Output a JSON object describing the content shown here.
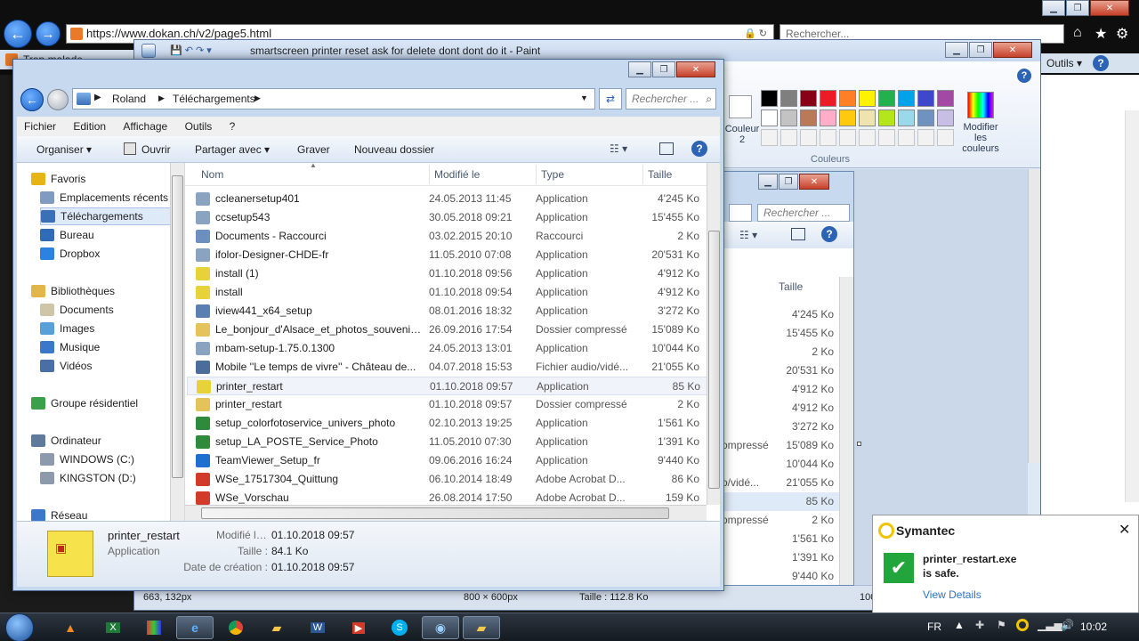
{
  "browser": {
    "url": "https://www.dokan.ch/v2/page5.html",
    "search_placeholder": "Rechercher...",
    "tab_label": "Trop malade",
    "toolbar_tools_label": "Outils"
  },
  "paint": {
    "title": "smartscreen printer reset ask for delete dont dont do it - Paint",
    "color2_label": "Couleur 2",
    "edit_colors_label": "Modifier les couleurs",
    "colors_group_label": "Couleurs",
    "status_pos": "663, 132px",
    "status_dim": "800 × 600px",
    "status_size": "Taille : 112.8 Ko",
    "status_zoom": "100%",
    "palette_row1": [
      "#000000",
      "#7f7f7f",
      "#880015",
      "#ed1c24",
      "#ff7f27",
      "#fff200",
      "#22b14c",
      "#00a2e8",
      "#3f48cc",
      "#a349a4"
    ],
    "palette_row2": [
      "#ffffff",
      "#c3c3c3",
      "#b97a57",
      "#ffaec9",
      "#ffc90e",
      "#efe4b0",
      "#b5e61d",
      "#99d9ea",
      "#7092be",
      "#c8bfe7"
    ]
  },
  "bg_explorer": {
    "search_placeholder": "Rechercher ...",
    "size_header": "Taille",
    "rows": [
      {
        "type": "",
        "size": "4'245 Ko"
      },
      {
        "type": "",
        "size": "15'455 Ko"
      },
      {
        "type": "",
        "size": "2 Ko"
      },
      {
        "type": "",
        "size": "20'531 Ko"
      },
      {
        "type": "",
        "size": "4'912 Ko"
      },
      {
        "type": "",
        "size": "4'912 Ko"
      },
      {
        "type": "",
        "size": "3'272 Ko"
      },
      {
        "type": "ompressé",
        "size": "15'089 Ko"
      },
      {
        "type": "",
        "size": "10'044 Ko"
      },
      {
        "type": "o/vidé...",
        "size": "21'055 Ko"
      },
      {
        "type": "",
        "size": "85 Ko"
      },
      {
        "type": "ompressé",
        "size": "2 Ko"
      },
      {
        "type": "",
        "size": "1'561 Ko"
      },
      {
        "type": "",
        "size": "1'391 Ko"
      },
      {
        "type": "",
        "size": "9'440 Ko"
      }
    ]
  },
  "explorer": {
    "breadcrumb": [
      "Roland",
      "Téléchargements"
    ],
    "search_placeholder": "Rechercher ...",
    "menu": [
      "Fichier",
      "Edition",
      "Affichage",
      "Outils",
      "?"
    ],
    "toolbar": {
      "organize": "Organiser",
      "open": "Ouvrir",
      "share": "Partager avec",
      "burn": "Graver",
      "new_folder": "Nouveau dossier"
    },
    "nav": [
      {
        "label": "Favoris",
        "icon": "star-icon",
        "color": "#e7b416",
        "indent": 0
      },
      {
        "label": "Emplacements récents",
        "icon": "recent-icon",
        "color": "#7f9bc2",
        "indent": 1
      },
      {
        "label": "Téléchargements",
        "icon": "downloads-icon",
        "color": "#3b6fb6",
        "indent": 1,
        "selected": true
      },
      {
        "label": "Bureau",
        "icon": "desktop-icon",
        "color": "#2f6bb8",
        "indent": 1
      },
      {
        "label": "Dropbox",
        "icon": "dropbox-icon",
        "color": "#2b82e0",
        "indent": 1
      },
      {
        "label": "Bibliothèques",
        "icon": "libraries-icon",
        "color": "#e4b64a",
        "indent": 0
      },
      {
        "label": "Documents",
        "icon": "documents-icon",
        "color": "#cfc6a8",
        "indent": 1
      },
      {
        "label": "Images",
        "icon": "images-icon",
        "color": "#5aa0d8",
        "indent": 1
      },
      {
        "label": "Musique",
        "icon": "music-icon",
        "color": "#3b78c9",
        "indent": 1
      },
      {
        "label": "Vidéos",
        "icon": "videos-icon",
        "color": "#4a6fa5",
        "indent": 1
      },
      {
        "label": "Groupe résidentiel",
        "icon": "homegroup-icon",
        "color": "#3aa04a",
        "indent": 0
      },
      {
        "label": "Ordinateur",
        "icon": "computer-icon",
        "color": "#5f7a9c",
        "indent": 0
      },
      {
        "label": "WINDOWS (C:)",
        "icon": "drive-icon",
        "color": "#8c9aab",
        "indent": 1
      },
      {
        "label": "KINGSTON (D:)",
        "icon": "usb-drive-icon",
        "color": "#8c9aab",
        "indent": 1
      },
      {
        "label": "Réseau",
        "icon": "network-icon",
        "color": "#3b78c9",
        "indent": 0
      }
    ],
    "columns": [
      "Nom",
      "Modifié le",
      "Type",
      "Taille"
    ],
    "files": [
      {
        "name": "ccleanersetup401",
        "date": "24.05.2013 11:45",
        "type": "Application",
        "size": "4'245 Ko",
        "color": "#8aa3c0"
      },
      {
        "name": "ccsetup543",
        "date": "30.05.2018 09:21",
        "type": "Application",
        "size": "15'455 Ko",
        "color": "#8aa3c0"
      },
      {
        "name": "Documents - Raccourci",
        "date": "03.02.2015 20:10",
        "type": "Raccourci",
        "size": "2 Ko",
        "color": "#6b8fbf"
      },
      {
        "name": "ifolor-Designer-CHDE-fr",
        "date": "11.05.2010 07:08",
        "type": "Application",
        "size": "20'531 Ko",
        "color": "#8aa3c0"
      },
      {
        "name": "install (1)",
        "date": "01.10.2018 09:56",
        "type": "Application",
        "size": "4'912 Ko",
        "color": "#e8d23a"
      },
      {
        "name": "install",
        "date": "01.10.2018 09:54",
        "type": "Application",
        "size": "4'912 Ko",
        "color": "#e8d23a"
      },
      {
        "name": "iview441_x64_setup",
        "date": "08.01.2016 18:32",
        "type": "Application",
        "size": "3'272 Ko",
        "color": "#5a7fb0"
      },
      {
        "name": "Le_bonjour_d'Alsace_et_photos_souvenir...",
        "date": "26.09.2016 17:54",
        "type": "Dossier compressé",
        "size": "15'089 Ko",
        "color": "#e3c35a"
      },
      {
        "name": "mbam-setup-1.75.0.1300",
        "date": "24.05.2013 13:01",
        "type": "Application",
        "size": "10'044 Ko",
        "color": "#8aa3c0"
      },
      {
        "name": "Mobile ''Le temps de vivre'' - Château de...",
        "date": "04.07.2018 15:53",
        "type": "Fichier audio/vidé...",
        "size": "21'055 Ko",
        "color": "#4b6d9a"
      },
      {
        "name": "printer_restart",
        "date": "01.10.2018 09:57",
        "type": "Application",
        "size": "85 Ko",
        "color": "#e8d23a",
        "selected": true
      },
      {
        "name": "printer_restart",
        "date": "01.10.2018 09:57",
        "type": "Dossier compressé",
        "size": "2 Ko",
        "color": "#e3c35a"
      },
      {
        "name": "setup_colorfotoservice_univers_photo",
        "date": "02.10.2013 19:25",
        "type": "Application",
        "size": "1'561 Ko",
        "color": "#2f8a3c"
      },
      {
        "name": "setup_LA_POSTE_Service_Photo",
        "date": "11.05.2010 07:30",
        "type": "Application",
        "size": "1'391 Ko",
        "color": "#2f8a3c"
      },
      {
        "name": "TeamViewer_Setup_fr",
        "date": "09.06.2016 16:24",
        "type": "Application",
        "size": "9'440 Ko",
        "color": "#1e6fd0"
      },
      {
        "name": "WSe_17517304_Quittung",
        "date": "06.10.2014 18:49",
        "type": "Adobe Acrobat D...",
        "size": "86 Ko",
        "color": "#d23a2a"
      },
      {
        "name": "WSe_Vorschau",
        "date": "26.08.2014 17:50",
        "type": "Adobe Acrobat D...",
        "size": "159 Ko",
        "color": "#d23a2a"
      }
    ],
    "details": {
      "name": "printer_restart",
      "kind": "Application",
      "modified_label": "Modifié le :",
      "modified_value": "01.10.2018 09:57",
      "size_label": "Taille :",
      "size_value": "84.1 Ko",
      "created_label": "Date de création :",
      "created_value": "01.10.2018 09:57"
    }
  },
  "symantec": {
    "brand": "Symantec",
    "message_line1": "printer_restart.exe",
    "message_line2": "is safe.",
    "link": "View Details"
  },
  "taskbar": {
    "lang": "FR",
    "time": "10:02"
  }
}
